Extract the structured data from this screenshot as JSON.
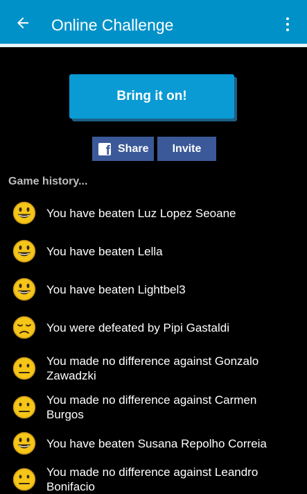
{
  "header": {
    "title": "Online Challenge",
    "back_icon": "arrow-left-icon",
    "menu_icon": "more-vert-icon",
    "color": "#0091c9"
  },
  "actions": {
    "challenge_label": "Bring it on!",
    "share_label": "Share",
    "invite_label": "Invite",
    "facebook_color": "#3b5998"
  },
  "history": {
    "title": "Game history...",
    "items": [
      {
        "text": "You have beaten Luz Lopez Seoane",
        "result": "win"
      },
      {
        "text": "You have beaten Lella",
        "result": "win"
      },
      {
        "text": "You have beaten Lightbel3",
        "result": "win"
      },
      {
        "text": "You were defeated by Pipi Gastaldi",
        "result": "loss"
      },
      {
        "text": "You made no difference against Gonzalo Zawadzki",
        "result": "draw"
      },
      {
        "text": "You made no difference against Carmen Burgos",
        "result": "draw"
      },
      {
        "text": "You have beaten Susana Repolho Correia",
        "result": "win"
      },
      {
        "text": "You made no difference against Leandro Bonifacio",
        "result": "draw"
      }
    ]
  }
}
